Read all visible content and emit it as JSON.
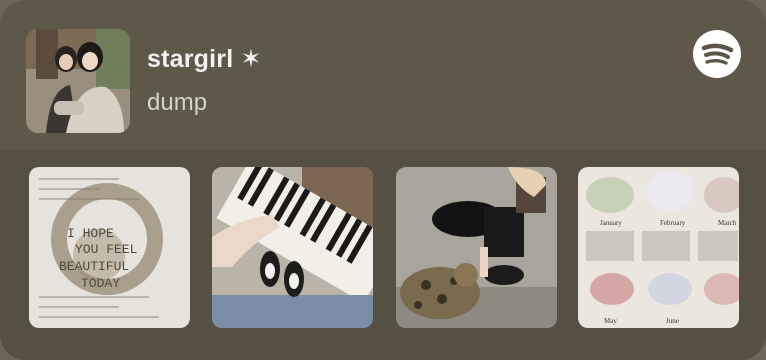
{
  "playlist": {
    "title": "stargirl ✶",
    "subtitle": "dump"
  },
  "icons": {
    "brand": "spotify-icon",
    "cover": "cover-photo",
    "thumbs": [
      "receipt-photo",
      "piano-photo",
      "cat-photo",
      "cake-calendar-photo"
    ]
  },
  "colors": {
    "card_top": "#5e5849",
    "card_bottom": "#555041",
    "title": "#f4f2ee",
    "subtitle": "#d7d2c8"
  },
  "receipt": {
    "text_lines": [
      "I HOPE",
      "YOU FEEL",
      "BEAUTIFUL",
      "TODAY"
    ]
  },
  "calendar": {
    "months": [
      "January",
      "February",
      "March",
      "May",
      "June"
    ]
  }
}
